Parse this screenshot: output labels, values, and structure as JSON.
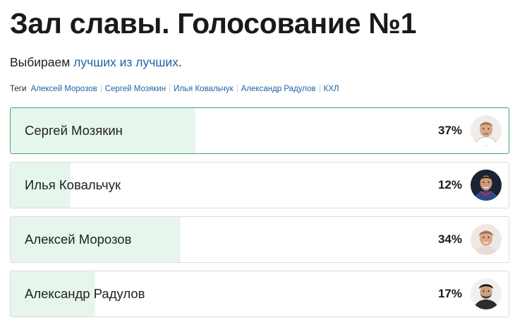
{
  "title": "Зал славы. Голосование №1",
  "lead": {
    "text": "Выбираем ",
    "link": "лучших из лучших",
    "suffix": "."
  },
  "tags": {
    "label": "Теги",
    "items": [
      "Алексей Морозов",
      "Сергей Мозякин",
      "Илья Ковальчук",
      "Александр Радулов",
      "КХЛ"
    ]
  },
  "poll": {
    "options": [
      {
        "name": "Сергей Мозякин",
        "percent_label": "37%",
        "share": 0.37,
        "selected": true,
        "avatar_icon": "player-mozyakin-photo"
      },
      {
        "name": "Илья Ковальчук",
        "percent_label": "12%",
        "share": 0.12,
        "selected": false,
        "avatar_icon": "player-kovalchuk-photo"
      },
      {
        "name": "Алексей Морозов",
        "percent_label": "34%",
        "share": 0.34,
        "selected": false,
        "avatar_icon": "player-morozov-photo"
      },
      {
        "name": "Александр Радулов",
        "percent_label": "17%",
        "share": 0.17,
        "selected": false,
        "avatar_icon": "player-radulov-photo"
      }
    ]
  },
  "colors": {
    "link": "#1f62a8",
    "selected_border": "#3fa56b",
    "bar_fill": "#e7f6ec"
  }
}
